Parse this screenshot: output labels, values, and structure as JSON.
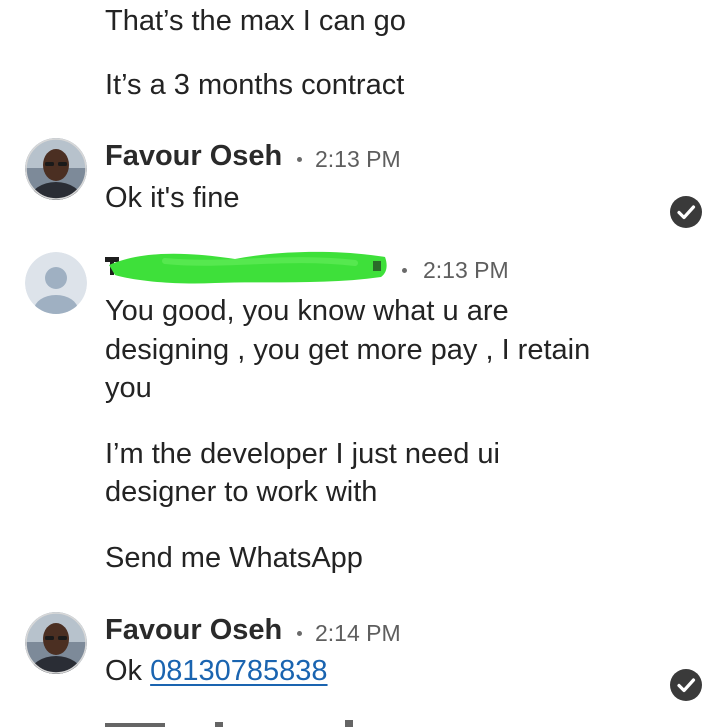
{
  "prior_messages": {
    "line1": "That’s the max I can go",
    "line2": "It’s a 3 months contract"
  },
  "message1": {
    "sender": "Favour Oseh",
    "time": "2:13 PM",
    "text": "Ok it's fine",
    "status_icon": "read-check-icon"
  },
  "message2": {
    "sender_redacted": true,
    "time": "2:13 PM",
    "paragraph1": [
      "You good,  you know what u are",
      "designing , you get more pay , I retain",
      "you"
    ],
    "paragraph2": [
      "I’m the developer I just need ui",
      "designer to work with"
    ],
    "paragraph3": "Send me WhatsApp"
  },
  "message3": {
    "sender": "Favour Oseh",
    "time": "2:14 PM",
    "text_prefix": "Ok",
    "phone": "08130785838",
    "status_icon": "read-check-icon"
  },
  "colors": {
    "link": "#1a64b0",
    "redaction": "#3ee03a",
    "check_bg": "#3a3a3a",
    "placeholder_avatar_bg": "#dde3ea",
    "placeholder_avatar_fg": "#9fb0c2"
  }
}
